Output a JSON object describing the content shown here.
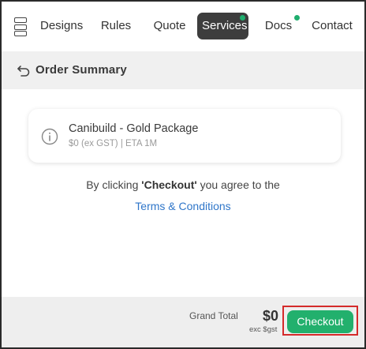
{
  "nav": {
    "items": [
      {
        "label": "Designs"
      },
      {
        "label": "Rules"
      },
      {
        "label": "Quote"
      },
      {
        "label": "Services"
      },
      {
        "label": "Docs"
      },
      {
        "label": "Contact"
      }
    ],
    "active": "Services",
    "menu_icon": "menu-icon",
    "notification_color": "#1fae6e"
  },
  "summary": {
    "title": "Order Summary",
    "back_icon": "back-arrow-icon"
  },
  "package": {
    "info_icon": "info-icon",
    "name": "Canibuild - Gold Package",
    "meta": "$0 (ex GST) | ETA 1M"
  },
  "agreement": {
    "prefix": "By clicking ",
    "bold": "'Checkout'",
    "suffix": " you agree to the",
    "link": "Terms & Conditions"
  },
  "footer": {
    "grand_total_label": "Grand Total",
    "grand_total_value": "$0",
    "grand_total_sub": "exc $gst",
    "checkout_label": "Checkout",
    "checkout_color": "#22b06d",
    "highlight_color": "#d42a2a"
  }
}
